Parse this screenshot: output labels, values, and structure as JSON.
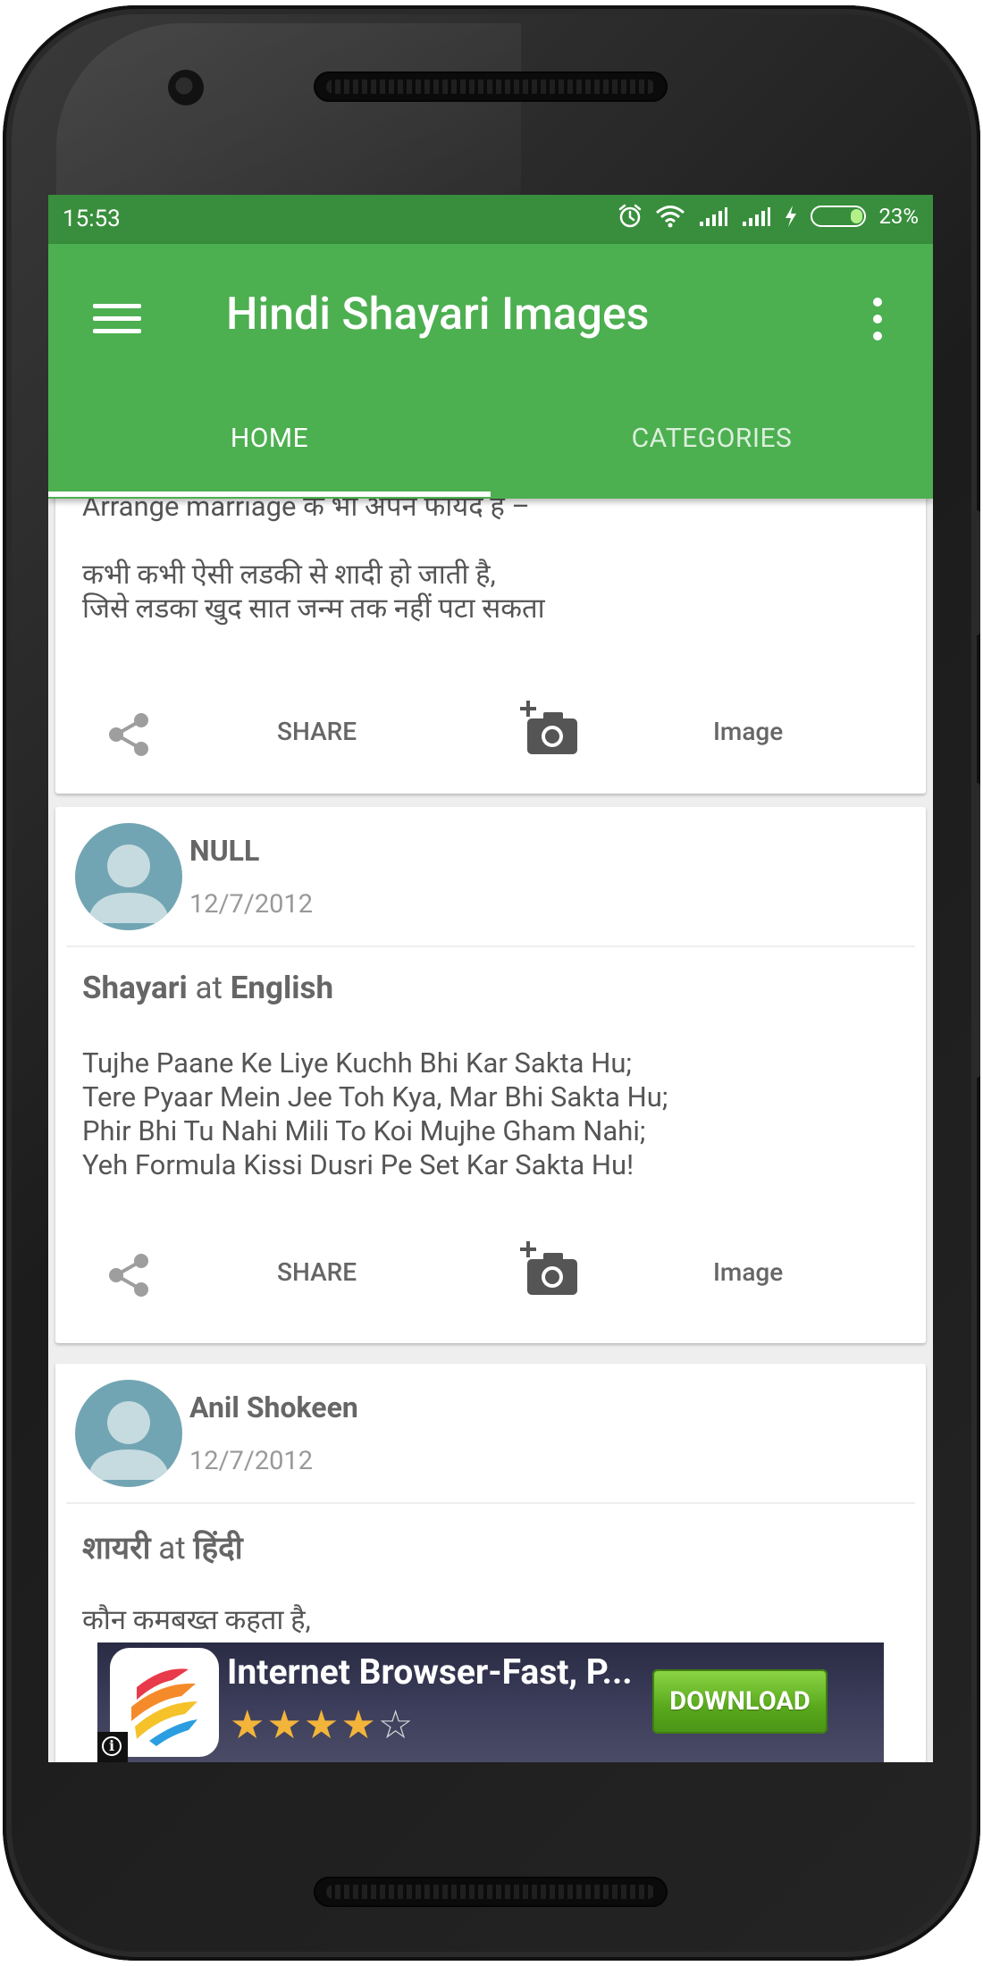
{
  "status_bar": {
    "time": "15:53",
    "battery_percent": "23%",
    "battery_level": 0.23,
    "icons": [
      "alarm-icon",
      "wifi-icon",
      "signal-icon",
      "signal-icon",
      "charging-icon"
    ]
  },
  "app_bar": {
    "title": "Hindi Shayari Images",
    "color": "#4CAF50",
    "status_color": "#388E3C"
  },
  "tabs": [
    {
      "label": "HOME",
      "selected": true
    },
    {
      "label": "CATEGORIES",
      "selected": false
    }
  ],
  "posts": [
    {
      "body": "Arrange marriage के भी अपने फायदे हैं –\n\nकभी कभी ऐसी लडकी से शादी हो जाती है,\nजिसे लडका खुद सात जन्म तक नहीं पटा सकता",
      "share_label": "SHARE",
      "image_label": "Image"
    },
    {
      "author": "NULL",
      "date": "12/7/2012",
      "category": "Shayari",
      "at": "at",
      "language": "English",
      "body": "Tujhe Paane Ke Liye Kuchh Bhi Kar Sakta Hu;\nTere Pyaar Mein Jee Toh Kya, Mar Bhi Sakta Hu;\nPhir Bhi Tu Nahi Mili To Koi Mujhe Gham Nahi;\nYeh Formula Kissi Dusri Pe Set Kar Sakta Hu!",
      "share_label": "SHARE",
      "image_label": "Image"
    },
    {
      "author": "Anil Shokeen",
      "date": "12/7/2012",
      "category": "शायरी",
      "at": "at",
      "language": "हिंदी",
      "body": "कौन कमबख्त कहता है,"
    }
  ],
  "ad": {
    "title": "Internet Browser-Fast, P...",
    "rating_stars": 4,
    "rating_max": 5,
    "button": "DOWNLOAD",
    "info_icon": "i"
  }
}
